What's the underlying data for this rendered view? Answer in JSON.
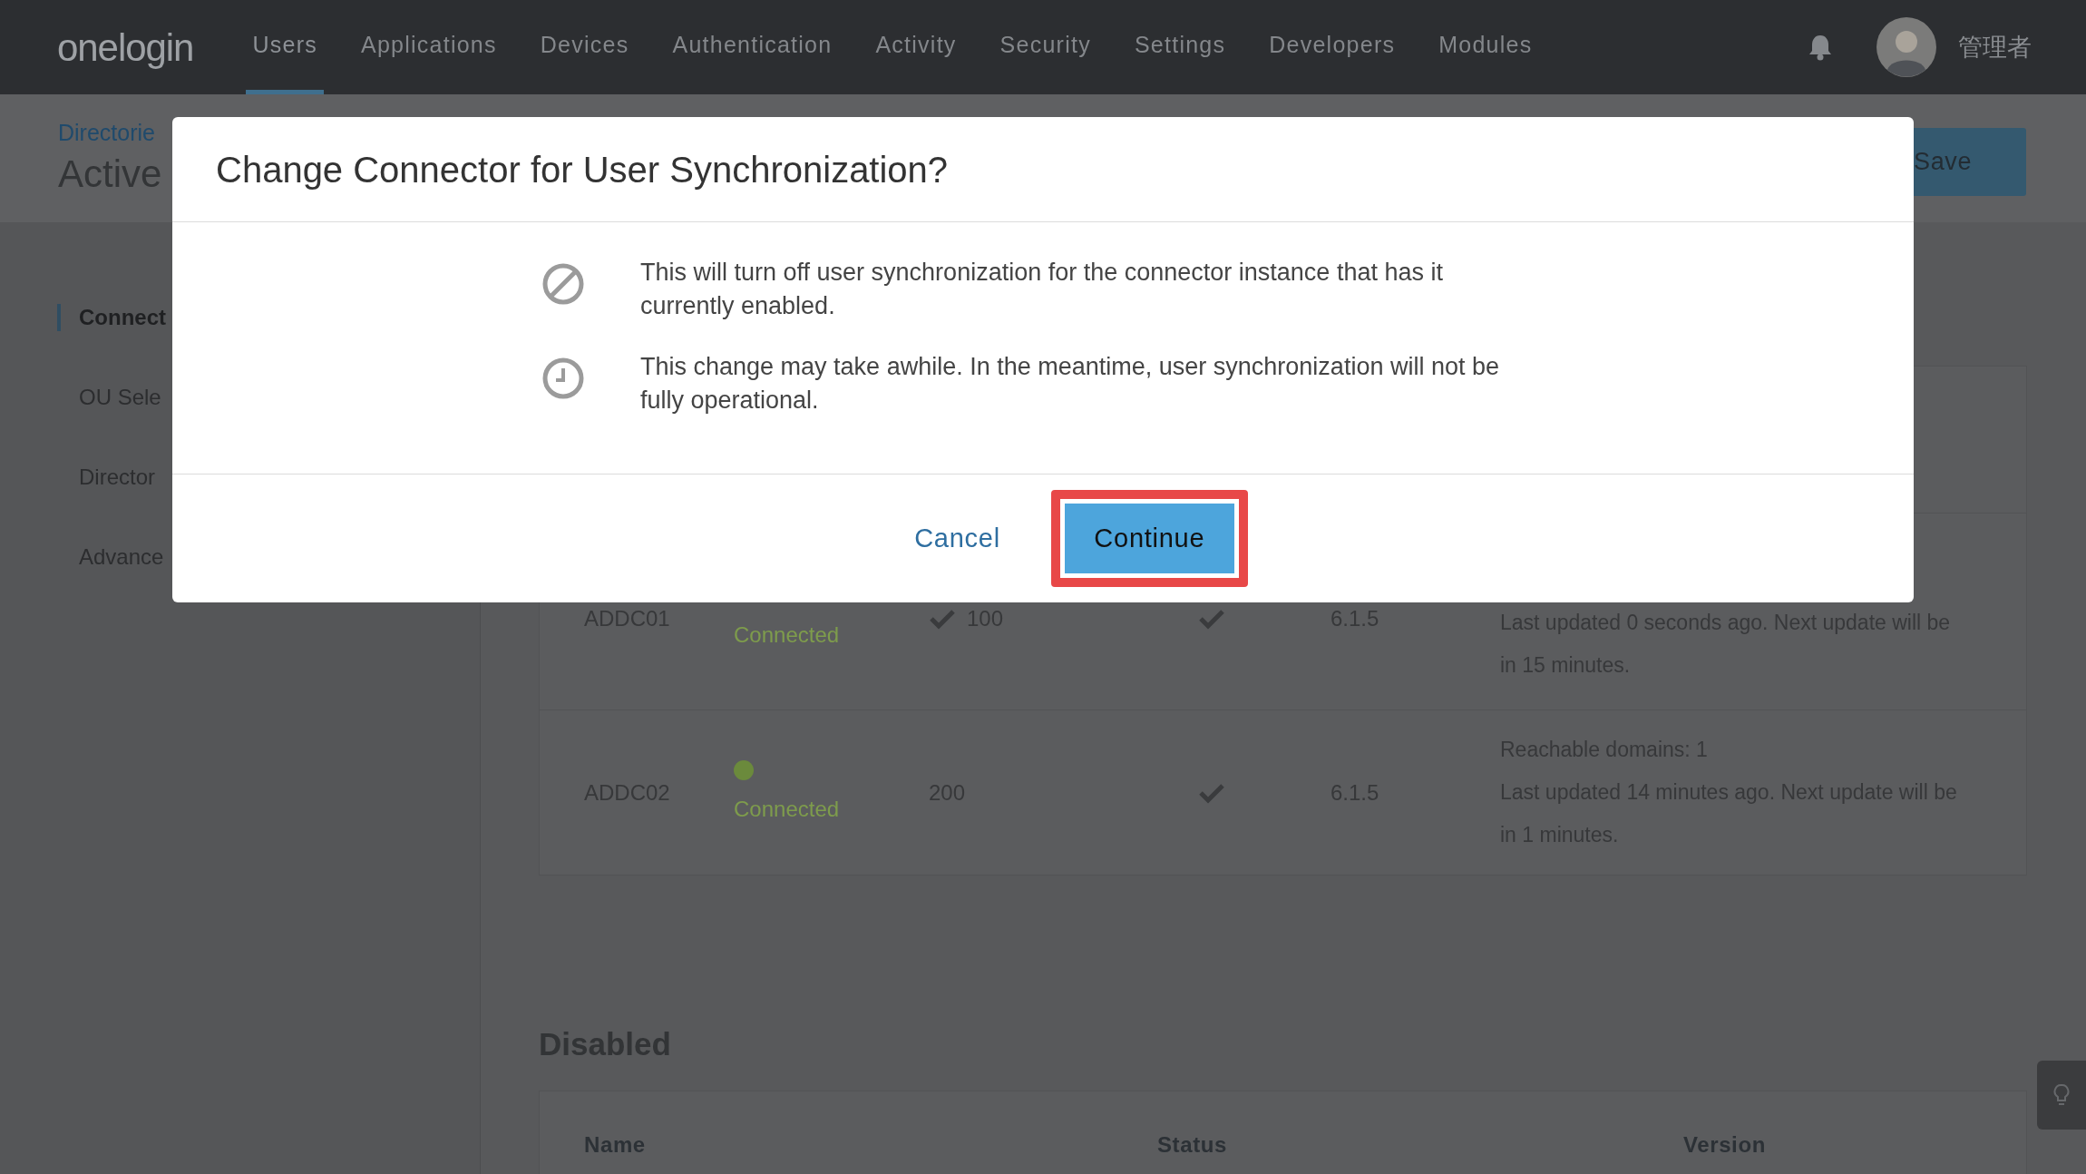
{
  "nav": {
    "logo": "onelogin",
    "items": [
      {
        "label": "Users",
        "selected": true
      },
      {
        "label": "Applications",
        "selected": false
      },
      {
        "label": "Devices",
        "selected": false
      },
      {
        "label": "Authentication",
        "selected": false
      },
      {
        "label": "Activity",
        "selected": false
      },
      {
        "label": "Security",
        "selected": false
      },
      {
        "label": "Settings",
        "selected": false
      },
      {
        "label": "Developers",
        "selected": false
      },
      {
        "label": "Modules",
        "selected": false
      }
    ],
    "user": "管理者"
  },
  "page_header": {
    "breadcrumb": "Directorie",
    "title": "Active",
    "save_button": "Save"
  },
  "sidebar": {
    "items": [
      {
        "label": "Connect",
        "selected": true
      },
      {
        "label": "OU Sele",
        "selected": false
      },
      {
        "label": "Director",
        "selected": false
      },
      {
        "label": "Advance",
        "selected": false
      }
    ]
  },
  "connectors": {
    "rows": [
      {
        "name": "ADDC01",
        "status": "Connected",
        "default": true,
        "value": "100",
        "checked": true,
        "version": "6.1.5",
        "details": [
          "Last updated 0 seconds ago. Next update will be in 15 minutes."
        ]
      },
      {
        "name": "ADDC02",
        "status": "Connected",
        "color": "#6b8a3c",
        "default": false,
        "value": "200",
        "checked": true,
        "version": "6.1.5",
        "details": [
          "Reachable domains: 1",
          "Last updated 14 minutes ago. Next update will be in 1 minutes."
        ]
      }
    ]
  },
  "disabled": {
    "title": "Disabled",
    "columns": [
      "Name",
      "Status",
      "Version"
    ]
  },
  "dialog": {
    "title": "Change Connector for User Synchronization?",
    "messages": [
      {
        "kind": "blocked",
        "text": "This will turn off user synchronization for the connector instance that has it currently enabled."
      },
      {
        "kind": "clock",
        "text": "This change may take awhile. In the meantime, user synchronization will not be fully operational."
      }
    ],
    "cancel": "Cancel",
    "confirm": "Continue"
  }
}
